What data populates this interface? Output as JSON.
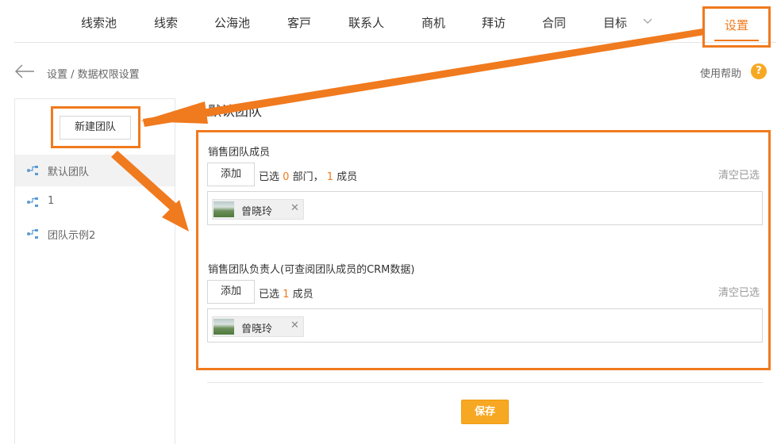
{
  "nav": {
    "items": [
      "线索池",
      "线索",
      "公海池",
      "客戸",
      "联系人",
      "商机",
      "拜访",
      "合同",
      "目标"
    ],
    "settings": "设置"
  },
  "breadcrumb": "设置 / 数据权限设置",
  "help": {
    "label": "使用帮助",
    "icon_text": "?"
  },
  "sidebar": {
    "new_team_button": "新建团队",
    "teams": [
      "默认团队",
      "1",
      "团队示例2"
    ]
  },
  "main": {
    "title": "默认团队",
    "members_section": {
      "label": "销售团队成员",
      "add_button": "添加",
      "selected_prefix": "已选",
      "dept_count": "0",
      "dept_unit": "部门，",
      "member_count": "1",
      "member_unit": "成员",
      "clear": "清空已选",
      "members": [
        "曾晓玲"
      ]
    },
    "leaders_section": {
      "label": "销售团队负责人(可查阅团队成员的CRM数据)",
      "add_button": "添加",
      "selected_prefix": "已选",
      "member_count": "1",
      "member_unit": "成员",
      "clear": "清空已选",
      "members": [
        "曾晓玲"
      ]
    },
    "save_button": "保存",
    "remove_glyph": "✕"
  },
  "colors": {
    "accent": "#f07a1e",
    "save": "#f7a823"
  }
}
